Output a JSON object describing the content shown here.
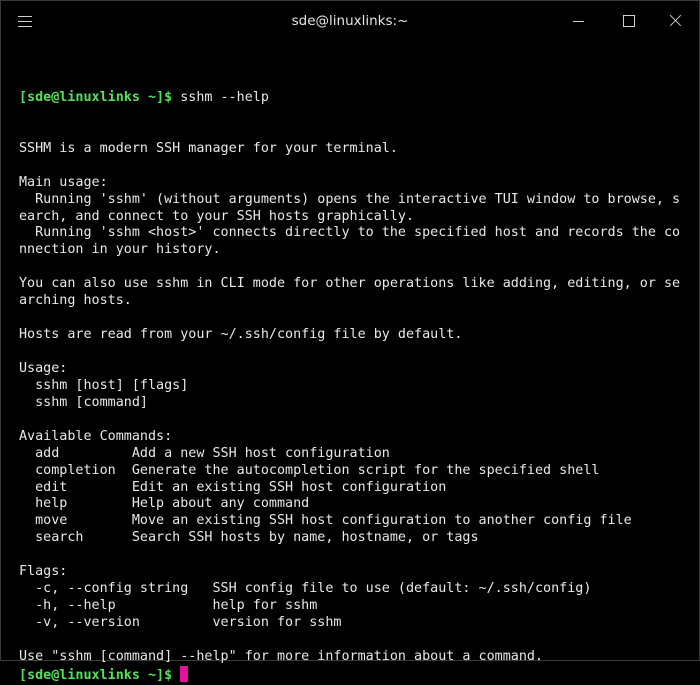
{
  "window": {
    "title": "sde@linuxlinks:~"
  },
  "terminal": {
    "prompt": "[sde@linuxlinks ~]$",
    "command": " sshm --help",
    "lines": [
      "SSHM is a modern SSH manager for your terminal.",
      "",
      "Main usage:",
      "  Running 'sshm' (without arguments) opens the interactive TUI window to browse, s",
      "earch, and connect to your SSH hosts graphically.",
      "  Running 'sshm <host>' connects directly to the specified host and records the co",
      "nnection in your history.",
      "",
      "You can also use sshm in CLI mode for other operations like adding, editing, or se",
      "arching hosts.",
      "",
      "Hosts are read from your ~/.ssh/config file by default.",
      "",
      "Usage:",
      "  sshm [host] [flags]",
      "  sshm [command]",
      "",
      "Available Commands:",
      "  add         Add a new SSH host configuration",
      "  completion  Generate the autocompletion script for the specified shell",
      "  edit        Edit an existing SSH host configuration",
      "  help        Help about any command",
      "  move        Move an existing SSH host configuration to another config file",
      "  search      Search SSH hosts by name, hostname, or tags",
      "",
      "Flags:",
      "  -c, --config string   SSH config file to use (default: ~/.ssh/config)",
      "  -h, --help            help for sshm",
      "  -v, --version         version for sshm",
      "",
      "Use \"sshm [command] --help\" for more information about a command."
    ],
    "final_prompt": "[sde@linuxlinks ~]$"
  },
  "colors": {
    "prompt": "#55e05a",
    "text": "#e8e8e8",
    "cursor": "#e3139e",
    "background": "#000000"
  },
  "icons": [
    "hamburger-menu-icon",
    "minimize-icon",
    "maximize-icon",
    "close-icon"
  ]
}
